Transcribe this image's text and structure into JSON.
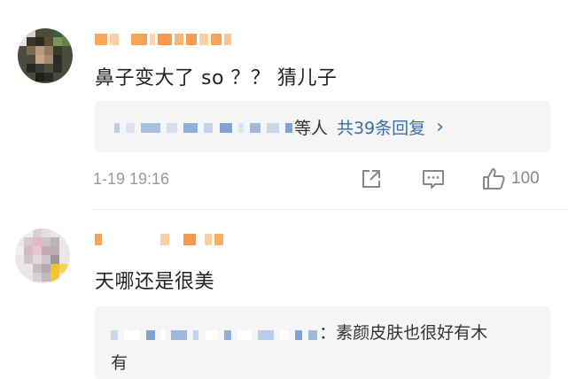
{
  "comments": [
    {
      "content": "鼻子变大了 so ？？ 猜儿子",
      "reply_summary": {
        "suffix": "等人",
        "link": "共39条回复",
        "chevron": "›"
      },
      "time": "1-19 19:16",
      "actions": {
        "share_icon": "share-icon",
        "comment_icon": "comment-icon",
        "like_icon": "like-icon",
        "like_count": "100"
      }
    },
    {
      "content": "天哪还是很美",
      "reply_preview": {
        "text_line1": "：素颜皮肤也很好有木",
        "text_line2": "有"
      }
    }
  ],
  "colors": {
    "link": "#3c6ea8",
    "nickname_orange": "#f7a45b",
    "meta_gray": "#999999",
    "reply_bg": "#f5f5f5"
  }
}
